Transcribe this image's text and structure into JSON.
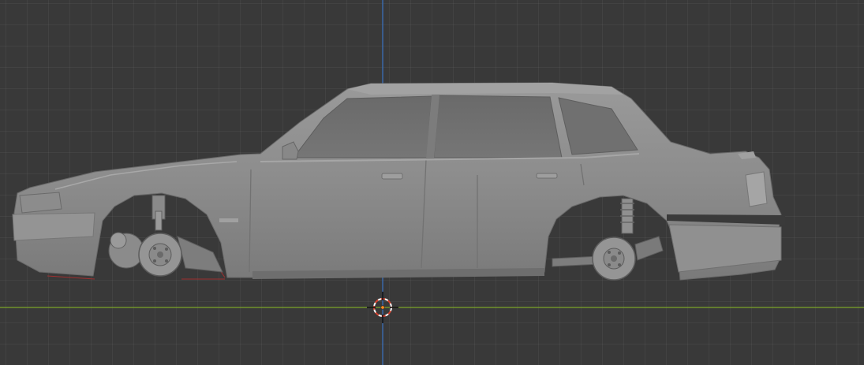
{
  "viewport": {
    "view": "side-orthographic",
    "colors": {
      "background": "#393939",
      "grid": "#444444",
      "x_axis": "#7ba428",
      "z_axis": "#3a6fb8",
      "mesh": "#8f8f8f",
      "mesh_shadow": "#6e6e6e",
      "glass": "#6d6d6d",
      "cursor_red": "#d8422e",
      "cursor_white": "#ffffff"
    },
    "objects": {
      "car": "sedan-mesh",
      "cursor": "3d-cursor-icon",
      "origin": "world-origin"
    }
  }
}
